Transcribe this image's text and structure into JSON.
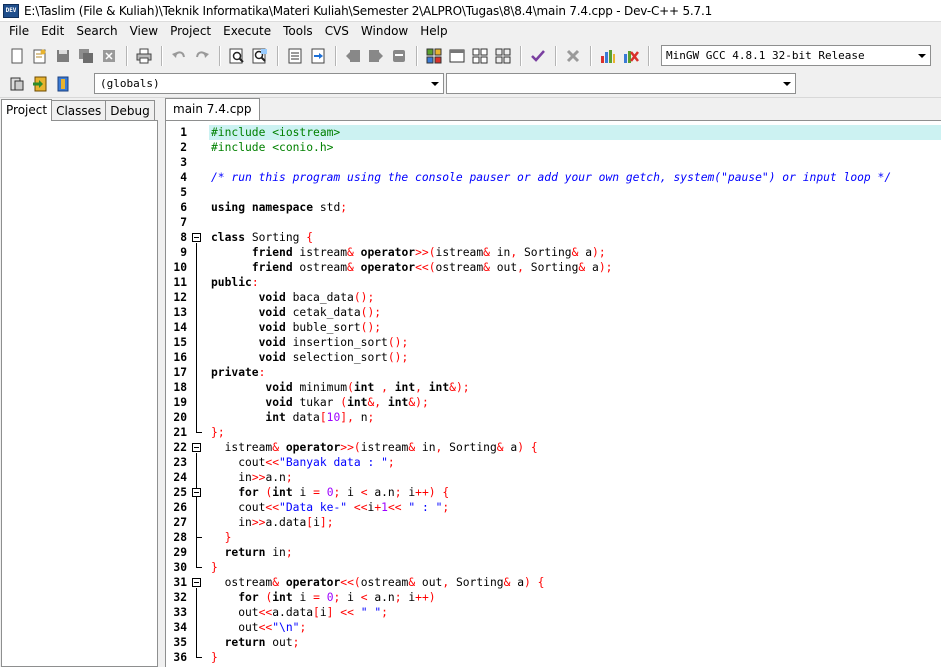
{
  "window": {
    "title": "E:\\Taslim (File & Kuliah)\\Teknik Informatika\\Materi Kuliah\\Semester 2\\ALPRO\\Tugas\\8\\8.4\\main 7.4.cpp - Dev-C++ 5.7.1",
    "app_icon_text": "DEV"
  },
  "menu": {
    "items": [
      "File",
      "Edit",
      "Search",
      "View",
      "Project",
      "Execute",
      "Tools",
      "CVS",
      "Window",
      "Help"
    ]
  },
  "toolbar": {
    "compiler": "MinGW GCC 4.8.1 32-bit Release",
    "scope_combo": "(globals)",
    "members_combo": ""
  },
  "left_panel": {
    "tabs": [
      "Project",
      "Classes",
      "Debug"
    ],
    "active_tab": "Project"
  },
  "editor": {
    "tab_label": "main 7.4.cpp",
    "current_line": 1,
    "colors": {
      "current_line_bg": "#ccf2f2",
      "preprocessor": "#008000",
      "comment": "#0000ff",
      "symbol": "#ff0000",
      "string": "#0000ff",
      "number": "#9d00ff"
    },
    "lines": [
      "#include <iostream>",
      "#include <conio.h>",
      "",
      "/* run this program using the console pauser or add your own getch, system(\"pause\") or input loop */",
      "",
      "using namespace std;",
      "",
      "class Sorting {",
      "      friend istream& operator>>(istream& in, Sorting& a);",
      "      friend ostream& operator<<(ostream& out, Sorting& a);",
      "public:",
      "       void baca_data();",
      "       void cetak_data();",
      "       void buble_sort();",
      "       void insertion_sort();",
      "       void selection_sort();",
      "private:",
      "        void minimum(int , int, int&);",
      "        void tukar (int&, int&);",
      "        int data[10], n;",
      "};",
      "  istream& operator>>(istream& in, Sorting& a) {",
      "    cout<<\"Banyak data : \";",
      "    in>>a.n;",
      "    for (int i = 0; i < a.n; i++) {",
      "    cout<<\"Data ke-\" <<i+1<< \" : \";",
      "    in>>a.data[i];",
      "  }",
      "  return in;",
      "}",
      "  ostream& operator<<(ostream& out, Sorting& a) {",
      "    for (int i = 0; i < a.n; i++)",
      "    out<<a.data[i] << \" \";",
      "    out<<\"\\n\";",
      "  return out;",
      "}"
    ]
  }
}
